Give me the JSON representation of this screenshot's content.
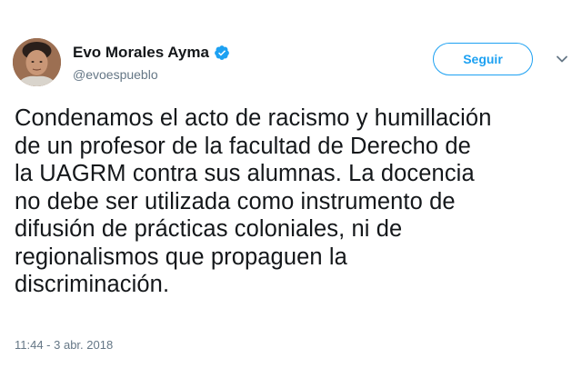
{
  "author": {
    "display_name": "Evo Morales Ayma",
    "handle": "@evoespueblo",
    "verified": true,
    "avatar_icon": "profile-photo"
  },
  "actions": {
    "follow_label": "Seguir",
    "menu_icon": "chevron-down-icon"
  },
  "tweet": {
    "lines": [
      "Condenamos el acto de racismo y humillación",
      "de un profesor de la facultad de Derecho de",
      "la UAGRM contra sus alumnas. La docencia",
      "no debe ser utilizada como instrumento de",
      "difusión de prácticas coloniales, ni de",
      "regionalismos que propaguen la",
      "discriminación."
    ],
    "timestamp": "11:44 - 3 abr. 2018"
  },
  "colors": {
    "accent": "#1da1f2",
    "secondary_text": "#657786",
    "primary_text": "#14171a"
  }
}
